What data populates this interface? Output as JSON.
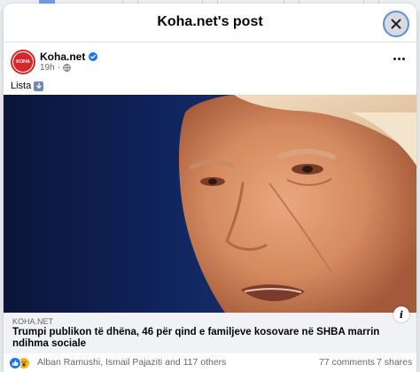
{
  "modal": {
    "title": "Koha.net's post"
  },
  "post": {
    "author": "Koha.net",
    "avatar_text": "KOHA",
    "time": "19h",
    "separator": "·",
    "text": "Lista"
  },
  "link": {
    "domain": "KOHA.NET",
    "title": "Trumpi publikon të dhëna, 46 për qind e familjeve kosovare në SHBA marrin ndihma sociale",
    "info_label": "i"
  },
  "stats": {
    "reactors": "Alban Ramushi, Ismail Pajaziti and 117 others",
    "comments": "77 comments",
    "shares": "7 shares"
  },
  "colors": {
    "brand_blue": "#1877f2",
    "koha_red": "#d62828",
    "secondary_text": "#65676b",
    "link_card_bg": "#f0f2f5"
  },
  "icons": {
    "close": "close-icon",
    "verified": "verified-badge-icon",
    "privacy": "globe-icon",
    "more": "more-options-icon",
    "emoji": "down-arrow-emoji-icon",
    "info": "info-icon",
    "reactions": [
      "like-reaction-icon",
      "wow-reaction-icon"
    ]
  }
}
